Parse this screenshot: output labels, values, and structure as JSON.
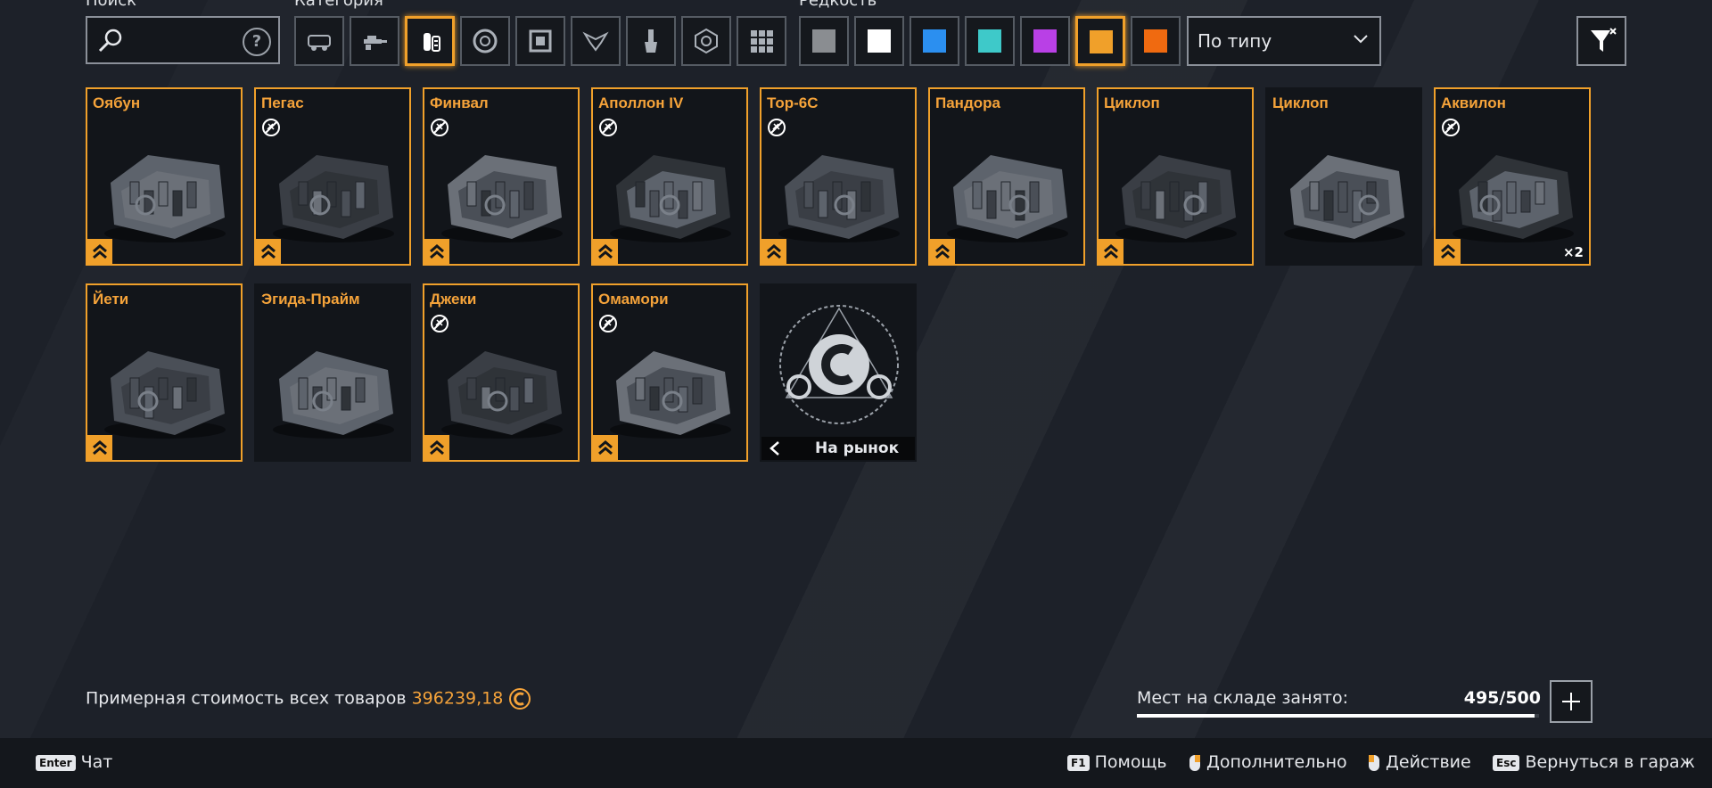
{
  "filters": {
    "search_label": "Поиск",
    "search_placeholder": "",
    "search_help_text": "?",
    "category_label": "Категория",
    "rarity_label": "Редкость",
    "sort_value": "По типу",
    "categories": [
      {
        "icon": "car-icon"
      },
      {
        "icon": "weapon-icon"
      },
      {
        "icon": "engine-icon",
        "active": true
      },
      {
        "icon": "wheel-icon"
      },
      {
        "icon": "frame-icon"
      },
      {
        "icon": "decor-icon"
      },
      {
        "icon": "paint-brush-icon"
      },
      {
        "icon": "hex-module-icon"
      },
      {
        "icon": "grid-all-icon"
      }
    ],
    "rarities": [
      {
        "name": "common",
        "color": "#8a8d91"
      },
      {
        "name": "uncommon",
        "color": "#ffffff"
      },
      {
        "name": "rare",
        "color": "#2b8ff0"
      },
      {
        "name": "special",
        "color": "#3ec9c9"
      },
      {
        "name": "epic",
        "color": "#b940e6"
      },
      {
        "name": "legendary",
        "color": "#f0a02a",
        "active": true
      },
      {
        "name": "relic",
        "color": "#f06a10"
      }
    ]
  },
  "items": [
    {
      "name": "Оябун",
      "no_sale": false,
      "upgrade": true,
      "quantity": ""
    },
    {
      "name": "Пегас",
      "no_sale": true,
      "upgrade": true,
      "quantity": ""
    },
    {
      "name": "Финвал",
      "no_sale": true,
      "upgrade": true,
      "quantity": ""
    },
    {
      "name": "Аполлон IV",
      "no_sale": true,
      "upgrade": true,
      "quantity": ""
    },
    {
      "name": "Тор-6С",
      "no_sale": true,
      "upgrade": true,
      "quantity": ""
    },
    {
      "name": "Пандора",
      "no_sale": false,
      "upgrade": true,
      "quantity": ""
    },
    {
      "name": "Циклоп",
      "no_sale": false,
      "upgrade": true,
      "quantity": ""
    },
    {
      "name": "Циклоп",
      "no_sale": false,
      "upgrade": false,
      "quantity": ""
    },
    {
      "name": "Аквилон",
      "no_sale": true,
      "upgrade": true,
      "quantity": "×2"
    },
    {
      "name": "Йети",
      "no_sale": false,
      "upgrade": true,
      "quantity": ""
    },
    {
      "name": "Эгида-Прайм",
      "no_sale": false,
      "upgrade": false,
      "quantity": ""
    },
    {
      "name": "Джеки",
      "no_sale": true,
      "upgrade": true,
      "quantity": ""
    },
    {
      "name": "Омамори",
      "no_sale": true,
      "upgrade": true,
      "quantity": ""
    }
  ],
  "market_tile": {
    "label": "На рынок"
  },
  "summary": {
    "cost_label": "Примерная стоимость всех товаров",
    "cost_value": "396239,18",
    "storage_label": "Мест на складе занято:",
    "storage_value": "495/500",
    "storage_fill": 0.99
  },
  "footer": {
    "chat_key": "Enter",
    "chat_label": "Чат",
    "help_key": "F1",
    "help_label": "Помощь",
    "more_label": "Дополнительно",
    "action_label": "Действие",
    "back_key": "Esc",
    "back_label": "Вернуться в гараж"
  }
}
